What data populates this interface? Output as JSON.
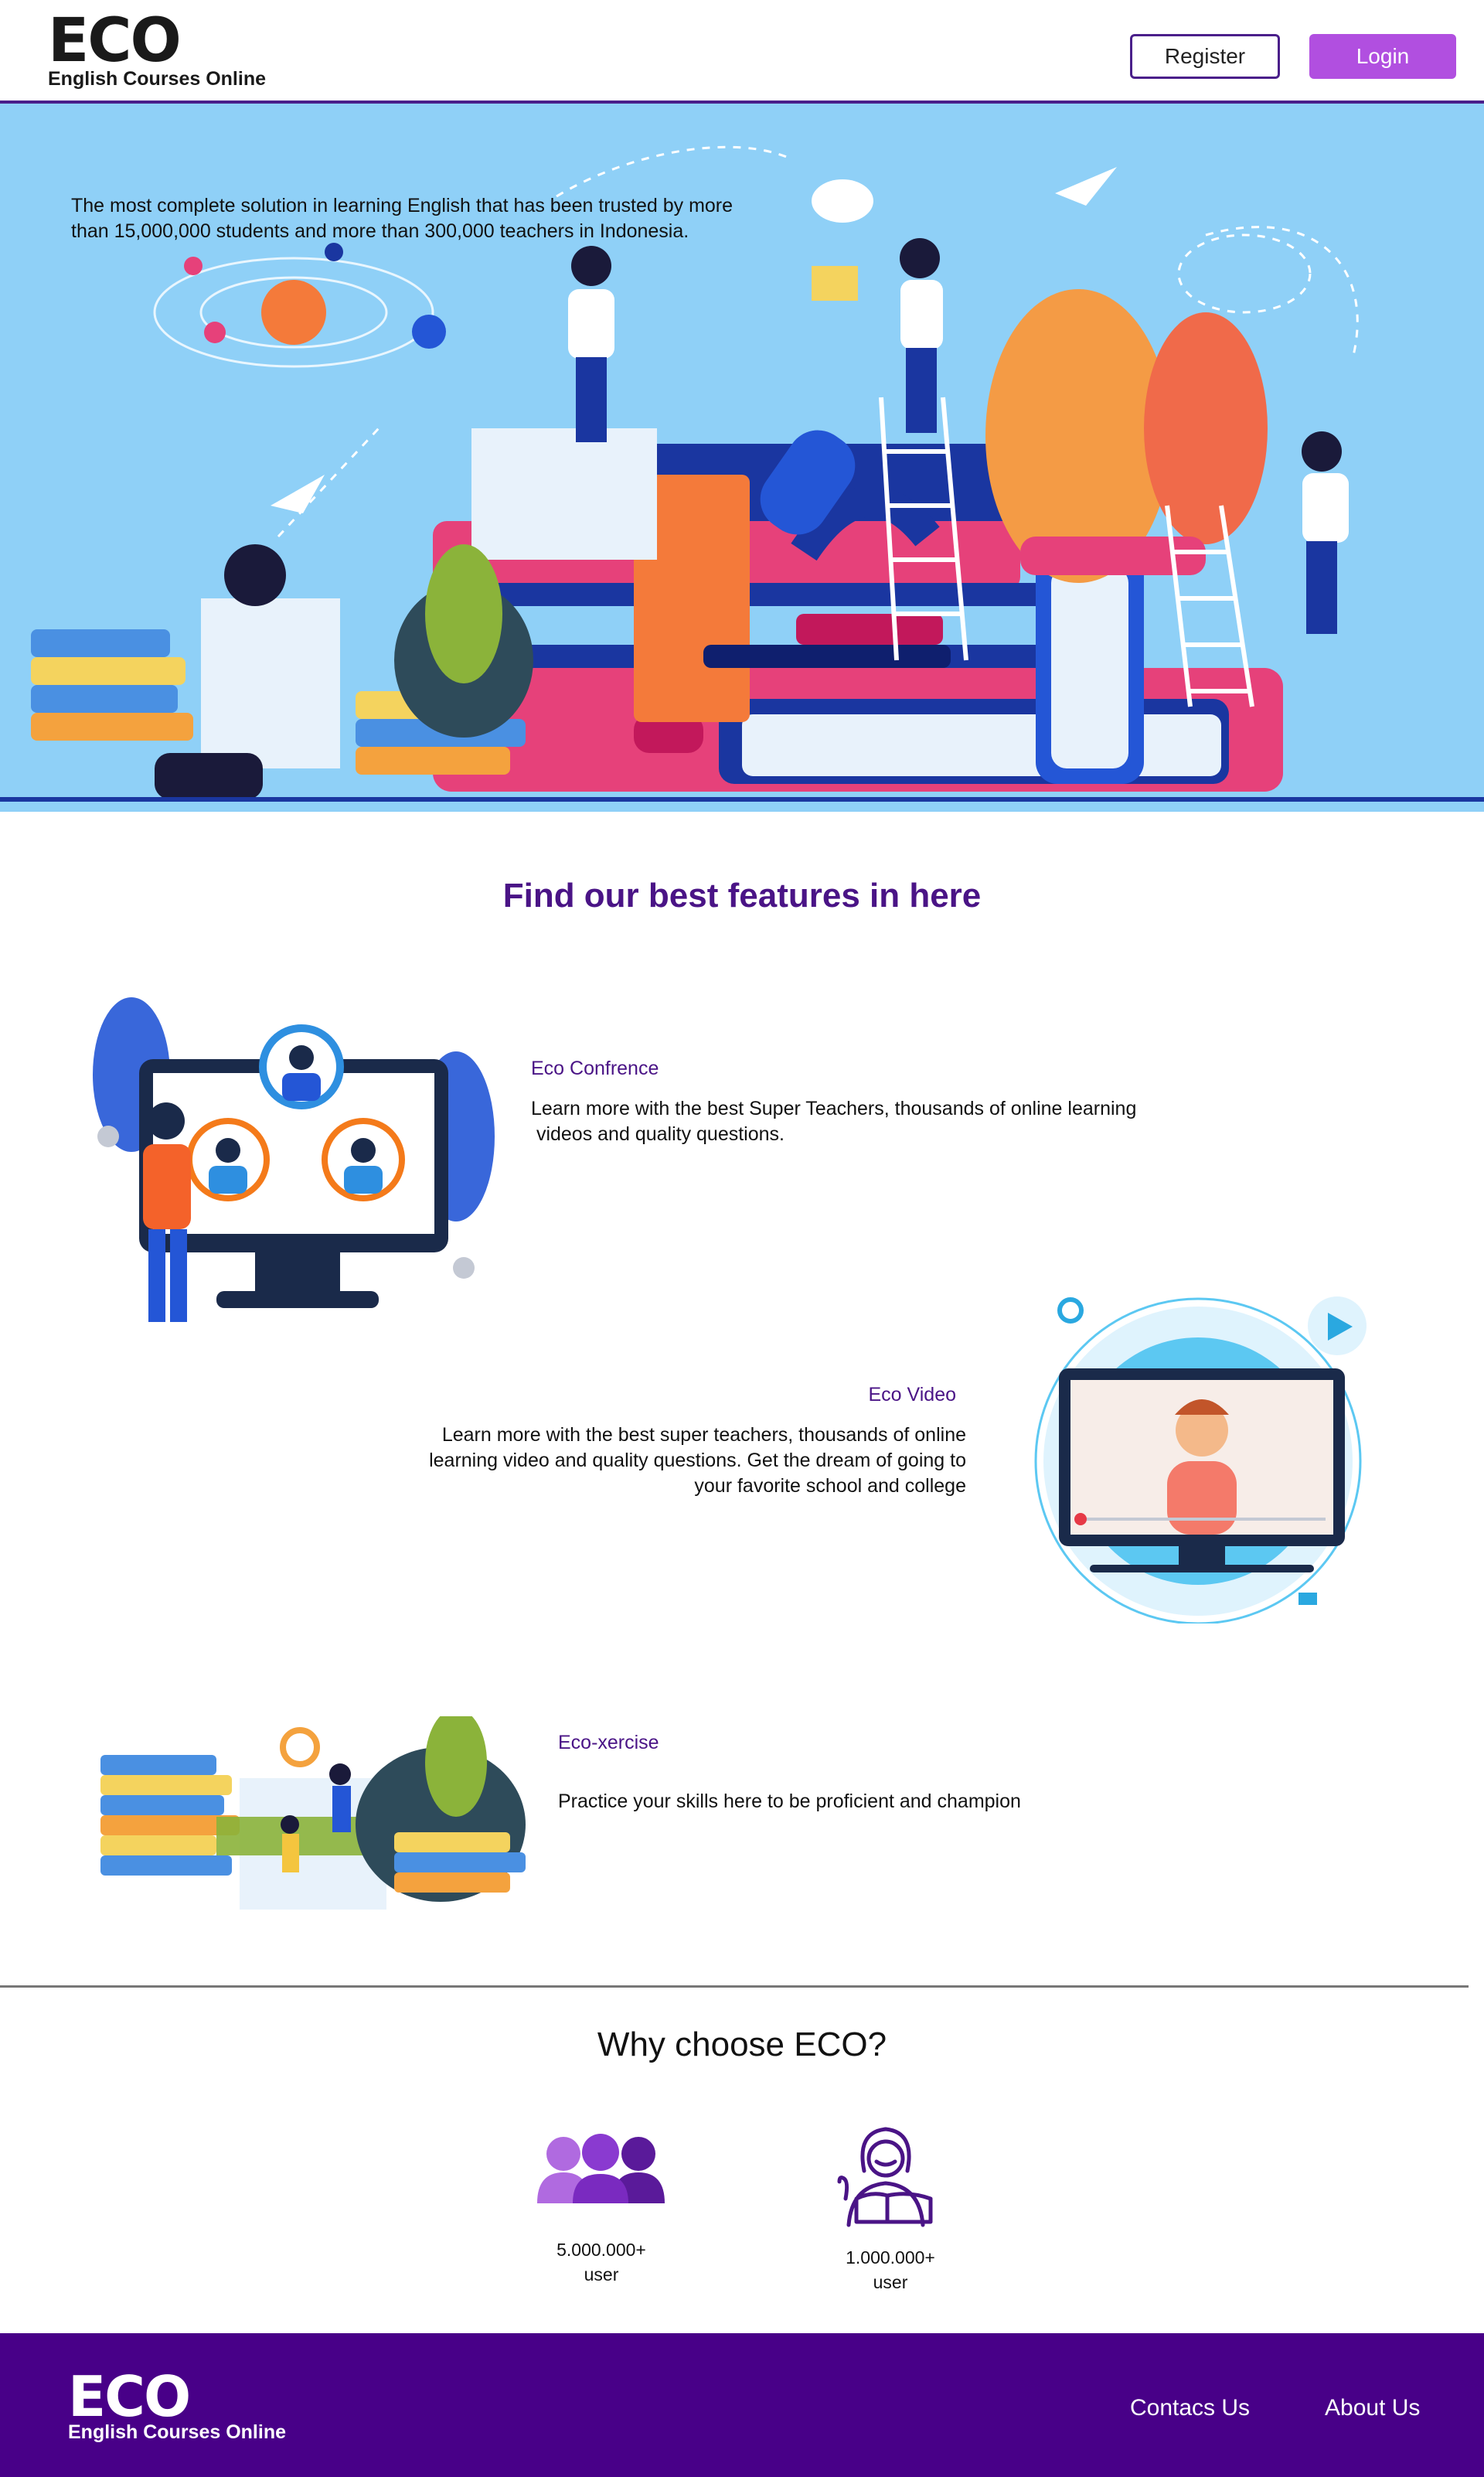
{
  "header": {
    "logo_text": "ECO",
    "logo_subtitle": "English Courses Online",
    "register_label": "Register",
    "login_label": "Login"
  },
  "hero": {
    "tagline_line1": "The most complete solution in learning English that has been trusted by more",
    "tagline_line2": "than 15,000,000 students and more than 300,000 teachers in Indonesia."
  },
  "features": {
    "section_title": "Find our best features in here",
    "items": [
      {
        "title": "Eco Confrence",
        "desc_line1": "Learn more with the best Super Teachers, thousands of online learning",
        "desc_line2": " videos and quality questions."
      },
      {
        "title": "Eco Video",
        "desc_line1": "Learn more with the best super teachers, thousands of online",
        "desc_line2": "learning video and quality questions. Get the dream of going to",
        "desc_line3": "your favorite school and college"
      },
      {
        "title": "Eco-xercise",
        "desc_line1": "Practice your skills here to be proficient and champion"
      }
    ]
  },
  "why": {
    "title": "Why choose ECO?",
    "stats": [
      {
        "value": "5.000.000+",
        "unit": "user",
        "icon": "users-group-icon"
      },
      {
        "value": "1.000.000+",
        "unit": "user",
        "icon": "student-reading-icon"
      }
    ]
  },
  "footer": {
    "logo_text": "ECO",
    "logo_subtitle": "English Courses Online",
    "links": [
      "Contacs Us",
      "About Us"
    ]
  },
  "colors": {
    "brand_purple": "#4a1486",
    "footer_purple": "#480088",
    "login_button": "#b14fe0",
    "hero_background": "#8fd0f7"
  }
}
